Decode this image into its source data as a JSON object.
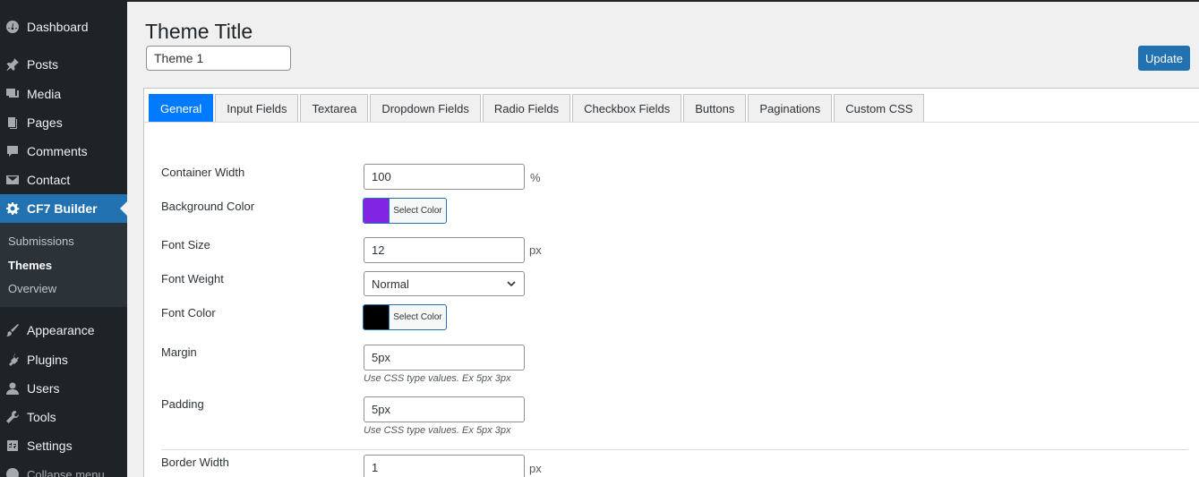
{
  "sidebar": {
    "items": [
      {
        "label": "Dashboard",
        "icon": "dashboard-icon"
      },
      {
        "label": "Posts",
        "icon": "pin-icon"
      },
      {
        "label": "Media",
        "icon": "media-icon"
      },
      {
        "label": "Pages",
        "icon": "pages-icon"
      },
      {
        "label": "Comments",
        "icon": "comment-icon"
      },
      {
        "label": "Contact",
        "icon": "mail-icon"
      },
      {
        "label": "CF7 Builder",
        "icon": "gear-icon"
      },
      {
        "label": "Appearance",
        "icon": "brush-icon"
      },
      {
        "label": "Plugins",
        "icon": "plug-icon"
      },
      {
        "label": "Users",
        "icon": "user-icon"
      },
      {
        "label": "Tools",
        "icon": "wrench-icon"
      },
      {
        "label": "Settings",
        "icon": "settings-icon"
      }
    ],
    "submenu": [
      "Submissions",
      "Themes",
      "Overview"
    ],
    "collapse_label": "Collapse menu"
  },
  "header": {
    "title": "Theme Title",
    "theme_name": "Theme 1",
    "update_label": "Update"
  },
  "tabs": [
    "General",
    "Input Fields",
    "Textarea",
    "Dropdown Fields",
    "Radio Fields",
    "Checkbox Fields",
    "Buttons",
    "Paginations",
    "Custom CSS"
  ],
  "form": {
    "container_width": {
      "label": "Container Width",
      "value": "100",
      "unit": "%"
    },
    "background_color": {
      "label": "Background Color",
      "button": "Select Color",
      "color": "#8224e3"
    },
    "font_size": {
      "label": "Font Size",
      "value": "12",
      "unit": "px"
    },
    "font_weight": {
      "label": "Font Weight",
      "value": "Normal"
    },
    "font_color": {
      "label": "Font Color",
      "button": "Select Color",
      "color": "#000000"
    },
    "margin": {
      "label": "Margin",
      "value": "5px",
      "hint": "Use CSS type values. Ex 5px 3px"
    },
    "padding": {
      "label": "Padding",
      "value": "5px",
      "hint": "Use CSS type values. Ex 5px 3px"
    },
    "border_width": {
      "label": "Border Width",
      "value": "1",
      "unit": "px"
    }
  },
  "colors": {
    "accent": "#2271b1",
    "active_tab": "#007bff",
    "sidebar_bg": "#1d2327"
  }
}
